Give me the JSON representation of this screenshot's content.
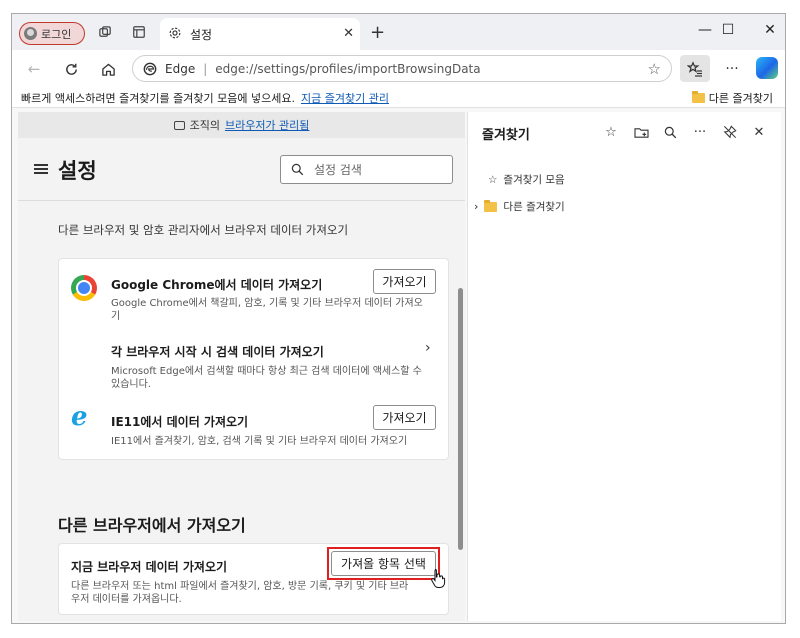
{
  "browser": {
    "profile_label": "로그인",
    "tab_title": "설정",
    "brand": "Edge",
    "url": "edge://settings/profiles/importBrowsingData",
    "icons": [
      "workspaces-icon",
      "tab-actions-icon",
      "gear-icon",
      "close-icon",
      "new-tab-icon",
      "back-icon",
      "refresh-icon",
      "home-icon",
      "star-icon",
      "favorites-icon",
      "more-icon",
      "copilot-icon"
    ]
  },
  "favbar": {
    "message": "빠르게 액세스하려면 즐겨찾기를 즐겨찾기 모음에 넣으세요.",
    "manage_link": "지금 즐겨찾기 관리",
    "other_favorites": "다른 즐겨찾기"
  },
  "managed": {
    "prefix": "조직의",
    "link": "브라우저가 관리됨"
  },
  "settings": {
    "title": "설정",
    "search_placeholder": "설정 검색",
    "description": "다른 브라우저 및 암호 관리자에서 브라우저 데이터 가져오기",
    "chrome": {
      "title": "Google Chrome에서 데이터 가져오기",
      "desc1": "Google Chrome에서 책갈피, 암호, 기록 및 기타 브라우저 데이터 가져오",
      "desc2": "기",
      "button": "가져오기"
    },
    "startup": {
      "title": "각 브라우저 시작 시 검색 데이터 가져오기",
      "desc1": "Microsoft Edge에서 검색할 때마다 항상 최근 검색 데이터에 액세스할 수",
      "desc2": "있습니다."
    },
    "ie11": {
      "title": "IE11에서 데이터 가져오기",
      "desc": "IE11에서 즐겨찾기, 암호, 검색 기록 및 기타 브라우저 데이터 가져오기",
      "button": "가져오기"
    },
    "other_section_title": "다른 브라우저에서 가져오기",
    "now": {
      "title": "지금 브라우저 데이터 가져오기",
      "desc1": "다른 브라우저 또는 html 파일에서 즐겨찾기, 암호, 방문 기록, 쿠키 및 기타 브라",
      "desc2": "우저 데이터를 가져옵니다.",
      "button": "가져올 항목 선택"
    }
  },
  "favorites_pane": {
    "title": "즐겨찾기",
    "items": [
      "즐겨찾기 모음",
      "다른 즐겨찾기"
    ]
  },
  "colors": {
    "accent_link": "#0f5ab5",
    "highlight": "#e11f1f"
  }
}
